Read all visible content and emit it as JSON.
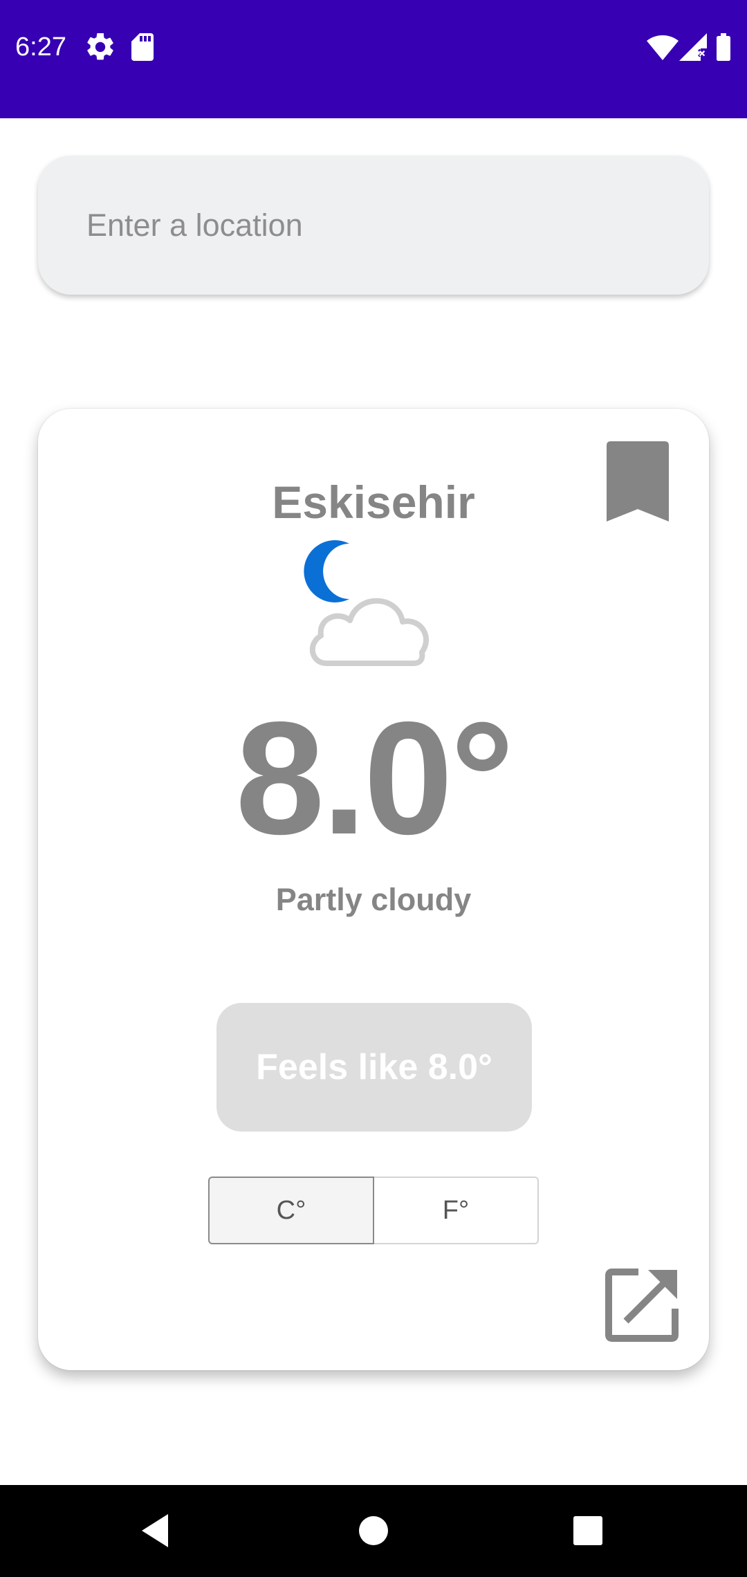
{
  "status_bar": {
    "time": "6:27",
    "background_color": "#3700b3",
    "icons": [
      "settings-icon",
      "sd-card-icon",
      "wifi-icon",
      "signal-icon",
      "battery-icon"
    ]
  },
  "search": {
    "placeholder": "Enter a location"
  },
  "weather": {
    "city": "Eskisehir",
    "condition_icon": "night-partly-cloudy-icon",
    "temperature": "8.0°",
    "condition": "Partly cloudy",
    "feels_like": "Feels like 8.0°",
    "units": {
      "celsius": "C°",
      "fahrenheit": "F°",
      "selected": "C°"
    }
  },
  "actions": {
    "bookmark_icon": "bookmark-icon",
    "open_icon": "open-external-icon"
  },
  "nav_bar": {
    "icons": [
      "back-icon",
      "home-icon",
      "recents-icon"
    ]
  }
}
